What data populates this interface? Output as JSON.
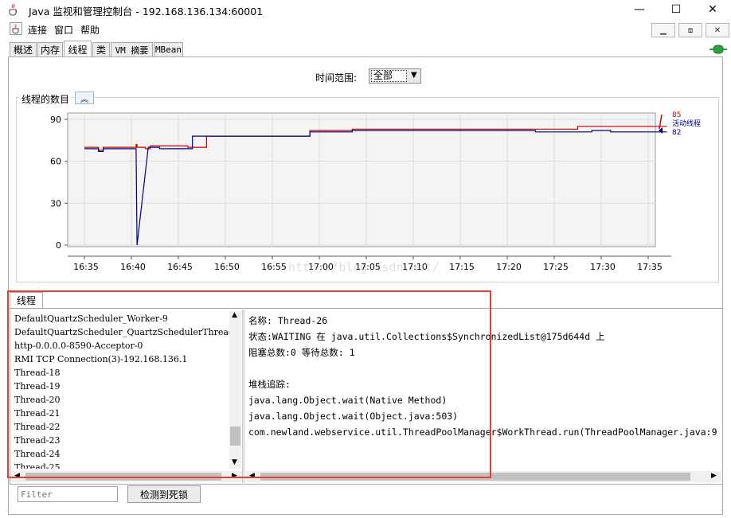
{
  "window": {
    "title": "Java 监视和管理控制台 - 192.168.136.134:60001",
    "minimize_glyph": "—",
    "maximize_glyph": "☐",
    "close_glyph": "✕"
  },
  "menu": {
    "items": [
      "连接",
      "窗口",
      "帮助"
    ]
  },
  "inner_controls": {
    "restore": "⧉",
    "tile": "⧈",
    "close": "✕"
  },
  "tabs": [
    {
      "label": "概述",
      "active": false
    },
    {
      "label": "内存",
      "active": false
    },
    {
      "label": "线程",
      "active": true
    },
    {
      "label": "类",
      "active": false
    },
    {
      "label": "VM 摘要",
      "active": false
    },
    {
      "label": "MBean",
      "active": false
    }
  ],
  "time_range": {
    "label": "时间范围:",
    "value": "全部"
  },
  "chart_section": {
    "title": "线程的数目",
    "collapse_glyph": "︽"
  },
  "chart_data": {
    "type": "line",
    "ylim": [
      0,
      90
    ],
    "yticks": [
      0,
      30,
      60,
      90
    ],
    "xticks": [
      "16:35",
      "16:40",
      "16:45",
      "16:50",
      "16:55",
      "17:00",
      "17:05",
      "17:10",
      "17:15",
      "17:20",
      "17:25",
      "17:30",
      "17:35"
    ],
    "xrange_minutes": [
      0,
      62
    ],
    "grid": true,
    "legend_position": "right",
    "series": [
      {
        "name": "",
        "color": "#cc0000",
        "end_value": 85,
        "points": [
          [
            0,
            70
          ],
          [
            1.5,
            70
          ],
          [
            1.5,
            68
          ],
          [
            2,
            68
          ],
          [
            2,
            70
          ],
          [
            5.5,
            70
          ],
          [
            5.5,
            72
          ],
          [
            5.6,
            72
          ],
          [
            5.6,
            70
          ],
          [
            6.5,
            70
          ],
          [
            6.5,
            69
          ],
          [
            7,
            69
          ],
          [
            7,
            71
          ],
          [
            11,
            71
          ],
          [
            11,
            70
          ],
          [
            13,
            70
          ],
          [
            13,
            78
          ],
          [
            24,
            78
          ],
          [
            24,
            82
          ],
          [
            28.5,
            82
          ],
          [
            28.5,
            83
          ],
          [
            52.5,
            83
          ],
          [
            52.5,
            85
          ],
          [
            62,
            85
          ]
        ]
      },
      {
        "name": "活动线程",
        "color": "#000080",
        "end_value": 82,
        "points": [
          [
            0,
            69
          ],
          [
            1.5,
            69
          ],
          [
            1.5,
            67
          ],
          [
            2,
            67
          ],
          [
            2,
            69
          ],
          [
            5.5,
            69
          ],
          [
            5.6,
            0
          ],
          [
            6.8,
            70
          ],
          [
            8,
            70
          ],
          [
            8,
            69
          ],
          [
            11.5,
            69
          ],
          [
            11.5,
            78
          ],
          [
            24,
            78
          ],
          [
            24,
            81
          ],
          [
            28.5,
            81
          ],
          [
            28.5,
            82
          ],
          [
            48,
            82
          ],
          [
            48,
            81
          ],
          [
            54,
            81
          ],
          [
            54,
            82
          ],
          [
            56,
            82
          ],
          [
            56,
            81
          ],
          [
            62,
            81
          ]
        ]
      }
    ],
    "labels": {
      "red_value": "85",
      "legend_text": "活动线程",
      "blue_value": "82"
    }
  },
  "watermark": "http://blog.csdn.net/",
  "threads_panel": {
    "tab_label": "线程",
    "threads": [
      "DefaultQuartzScheduler_Worker-9",
      "DefaultQuartzScheduler_QuartzSchedulerThread",
      "http-0.0.0.0-8590-Acceptor-0",
      "RMI TCP Connection(3)-192.168.136.1",
      "Thread-18",
      "Thread-19",
      "Thread-20",
      "Thread-21",
      "Thread-22",
      "Thread-23",
      "Thread-24",
      "Thread-25"
    ],
    "details": [
      "名称:  Thread-26",
      "状态:WAITING 在 java.util.Collections$SynchronizedList@175d644d 上",
      "阻塞总数:0  等待总数: 1",
      "",
      "堆栈追踪:",
      "java.lang.Object.wait(Native Method)",
      "java.lang.Object.wait(Object.java:503)",
      "com.newland.webservice.util.ThreadPoolManager$WorkThread.run(ThreadPoolManager.java:9"
    ]
  },
  "filter": {
    "placeholder": "Filter",
    "value": ""
  },
  "detect_deadlock_button": "检测到死锁",
  "colors": {
    "highlight_box": "#e83b3b",
    "red_series": "#cc0000",
    "blue_series": "#000080",
    "connected_icon": "#2ea043"
  }
}
